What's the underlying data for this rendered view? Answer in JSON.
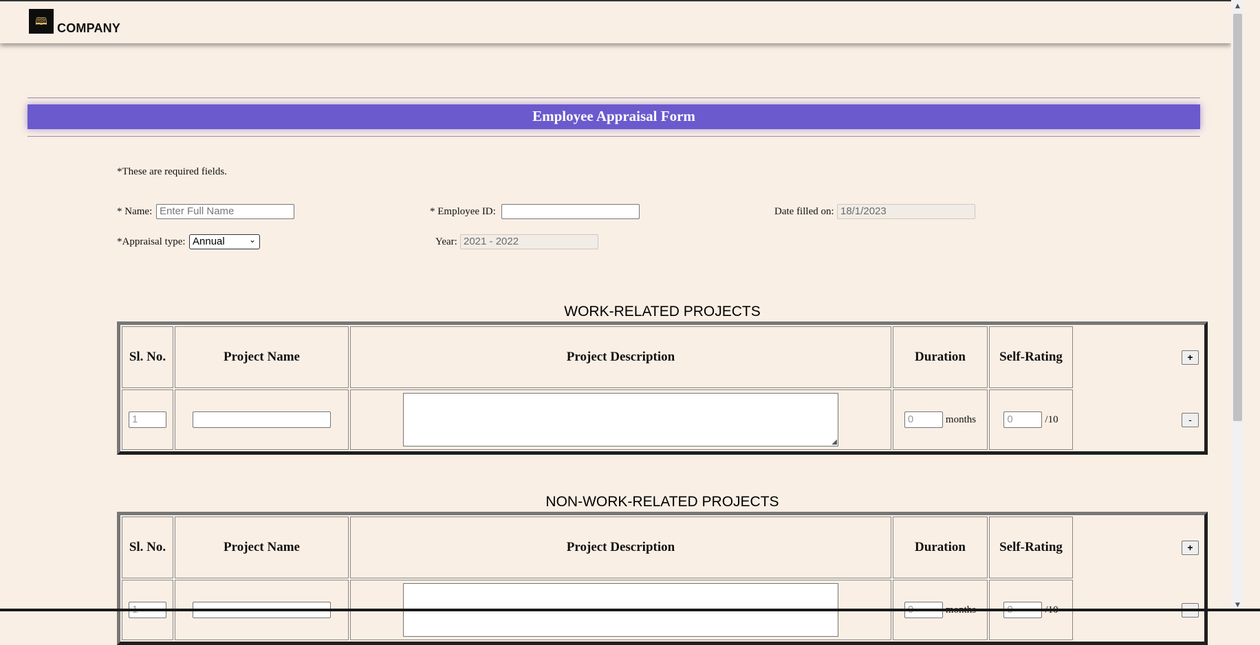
{
  "header": {
    "company": "COMPANY"
  },
  "form": {
    "title": "Employee Appraisal Form",
    "required_note": "*These are required fields.",
    "name_label": "* Name:",
    "name_placeholder": "Enter Full Name",
    "employee_id_label": "* Employee ID:",
    "date_label": "Date filled on:",
    "date_value": "18/1/2023",
    "appraisal_type_label": "*Appraisal type:",
    "appraisal_type_value": "Annual",
    "year_label": "Year:",
    "year_value": "2021 - 2022"
  },
  "columns": {
    "sl_no": "Sl. No.",
    "project_name": "Project Name",
    "project_description": "Project Description",
    "duration": "Duration",
    "self_rating": "Self-Rating"
  },
  "work_projects": {
    "title": "WORK-RELATED PROJECTS",
    "row": {
      "sl_no": "1",
      "duration": "0",
      "duration_unit": "months",
      "rating": "0",
      "rating_suffix": "/10"
    }
  },
  "non_work_projects": {
    "title": "NON-WORK-RELATED PROJECTS",
    "row": {
      "sl_no": "1",
      "duration": "0",
      "duration_unit": "months",
      "rating": "0",
      "rating_suffix": "/10"
    }
  },
  "buttons": {
    "add": "+",
    "remove": "-"
  },
  "colors": {
    "banner": "#6a5acd",
    "background": "#faefe5",
    "logo_bg": "#0d0d0d"
  },
  "icons": {
    "logo": "book-logo-icon",
    "select_arrow": "chevron-down-icon"
  }
}
